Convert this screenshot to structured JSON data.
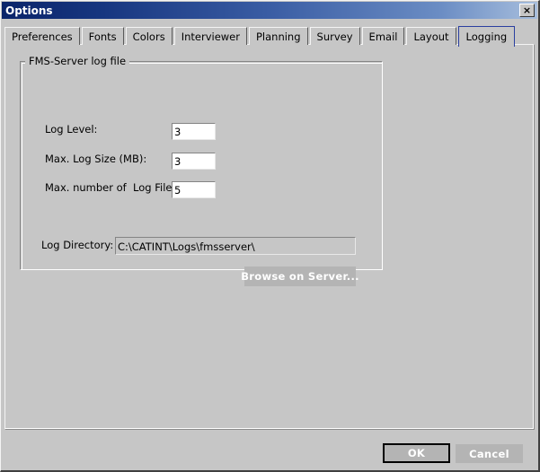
{
  "window": {
    "title": "Options",
    "close_label": "×",
    "close_glyph": "✕"
  },
  "tabs": [
    {
      "label": "Preferences",
      "selected": false
    },
    {
      "label": "Fonts",
      "selected": false
    },
    {
      "label": "Colors",
      "selected": false
    },
    {
      "label": "Interviewer",
      "selected": false
    },
    {
      "label": "Planning",
      "selected": false
    },
    {
      "label": "Survey",
      "selected": false
    },
    {
      "label": "Email",
      "selected": false
    },
    {
      "label": "Layout",
      "selected": false
    },
    {
      "label": "Logging",
      "selected": true
    }
  ],
  "group": {
    "title": "FMS-Server log file"
  },
  "fields": {
    "log_level": {
      "label": "Log Level:",
      "value": "3"
    },
    "max_log_size": {
      "label": "Max. Log Size (MB):",
      "value": "3"
    },
    "max_log_files": {
      "label": "Max. number of  Log Files:",
      "value": "5"
    },
    "log_directory": {
      "label": "Log Directory:",
      "value": "C:\\CATINT\\Logs\\fmsserver\\"
    }
  },
  "buttons": {
    "browse": "Browse on Server...",
    "ok": "OK",
    "cancel": "Cancel"
  },
  "colors": {
    "face": "#c6c6c6",
    "title_gradient_start": "#0a246a",
    "title_gradient_end": "#a7bedd",
    "selected_tab_border": "#2a3fa0",
    "button_face": "#b4b4b4",
    "button_text": "#ffffff"
  }
}
